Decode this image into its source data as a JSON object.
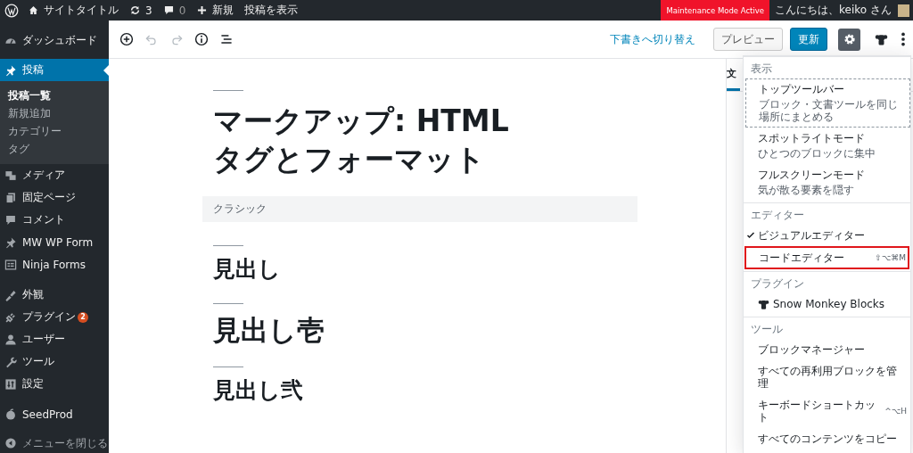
{
  "admin_bar": {
    "site_title": "サイトタイトル",
    "updates": "3",
    "comments": "0",
    "new": "新規",
    "view_post": "投稿を表示",
    "maintenance": "Maintenance Mode Active",
    "greeting": "こんにちは、keiko さん"
  },
  "sidebar": {
    "groups": [
      {
        "items": [
          {
            "label": "ダッシュボード",
            "selected": false
          },
          {
            "label": "投稿",
            "selected": true,
            "children": [
              {
                "label": "投稿一覧",
                "selected": true
              },
              {
                "label": "新規追加",
                "selected": false
              },
              {
                "label": "カテゴリー",
                "selected": false
              },
              {
                "label": "タグ",
                "selected": false
              }
            ]
          },
          {
            "label": "メディア",
            "selected": false
          },
          {
            "label": "固定ページ",
            "selected": false
          },
          {
            "label": "コメント",
            "selected": false
          },
          {
            "label": "MW WP Form",
            "selected": false
          },
          {
            "label": "Ninja Forms",
            "selected": false
          }
        ]
      },
      {
        "items": [
          {
            "label": "外観",
            "selected": false
          },
          {
            "label": "プラグイン",
            "selected": false,
            "badge": "2"
          },
          {
            "label": "ユーザー",
            "selected": false
          },
          {
            "label": "ツール",
            "selected": false
          },
          {
            "label": "設定",
            "selected": false
          }
        ]
      },
      {
        "items": [
          {
            "label": "SeedProd",
            "selected": false
          }
        ]
      }
    ],
    "collapse": "メニューを閉じる"
  },
  "toolbar": {
    "tools": [
      {
        "disabled": false
      },
      {
        "disabled": true
      },
      {
        "disabled": true
      },
      {
        "disabled": false
      },
      {
        "disabled": false
      }
    ],
    "switch_to_draft": "下書きへ切り替え",
    "preview": "プレビュー",
    "update": "更新",
    "settings_active": true
  },
  "content": {
    "title_lines": [
      "マークアップ: HTML",
      "タグとフォーマット"
    ],
    "classic_label": "クラシック",
    "headings": [
      {
        "text": "見出し",
        "kind": "small"
      },
      {
        "text": "見出し壱",
        "kind": "large"
      },
      {
        "text": "見出し弐",
        "kind": "small"
      }
    ]
  },
  "settings_sidebar": {
    "tab": "文"
  },
  "more_menu": {
    "sections": [
      {
        "title": "表示",
        "items": [
          {
            "label": "トップツールバー",
            "description": "ブロック・文書ツールを同じ場所にまとめる",
            "focused": true
          },
          {
            "label": "スポットライトモード",
            "description": "ひとつのブロックに集中",
            "focused": false
          },
          {
            "label": "フルスクリーンモード",
            "description": "気が散る要素を隠す",
            "focused": false
          }
        ]
      },
      {
        "title": "エディター",
        "items": [
          {
            "label": "ビジュアルエディター",
            "checked": true,
            "highlighted": false
          },
          {
            "label": "コードエディター",
            "checked": false,
            "shortcut": "⇧⌥⌘M",
            "highlighted": true
          }
        ]
      },
      {
        "title": "プラグイン",
        "items": [
          {
            "label": "Snow Monkey Blocks",
            "kind": "plugin"
          }
        ]
      },
      {
        "title": "ツール",
        "items": [
          {
            "label": "ブロックマネージャー"
          },
          {
            "label": "すべての再利用ブロックを管理"
          },
          {
            "label": "キーボードショートカット",
            "shortcut": "^⌥H"
          },
          {
            "label": "すべてのコンテンツをコピー"
          }
        ]
      }
    ]
  }
}
